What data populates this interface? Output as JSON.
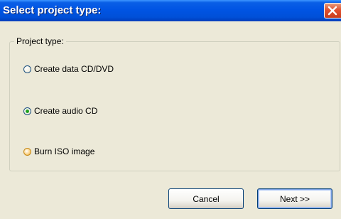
{
  "dialog": {
    "title": "Select project type:"
  },
  "project_type_group": {
    "legend": "Project type:",
    "options": [
      {
        "label": "Create data CD/DVD",
        "checked": false
      },
      {
        "label": "Create audio CD",
        "checked": true
      },
      {
        "label": "Burn ISO image",
        "checked": false
      }
    ]
  },
  "buttons": {
    "cancel_label": "Cancel",
    "next_label": "Next >>"
  },
  "colors": {
    "titlebar": "#0054e3",
    "close_button": "#e2512f",
    "dialog_background": "#ece9d8",
    "selected_dot": "#21a121",
    "hover_ring": "#e8a331"
  }
}
